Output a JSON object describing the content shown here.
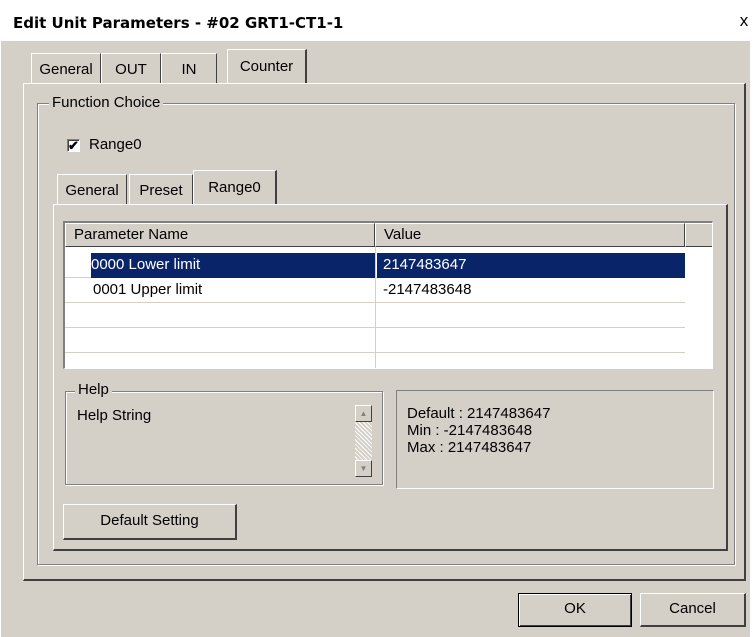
{
  "window": {
    "title": "Edit Unit Parameters - #02 GRT1-CT1-1",
    "close_glyph": "x"
  },
  "top_tabs": [
    "General",
    "OUT",
    "IN",
    "Counter"
  ],
  "function_choice": {
    "label": "Function Choice",
    "range_checkbox": {
      "label": "Range0",
      "checked": true,
      "mark": "✔"
    }
  },
  "sub_tabs": [
    "General",
    "Preset",
    "Range0"
  ],
  "param_table": {
    "columns": [
      "Parameter Name",
      "Value"
    ],
    "rows": [
      {
        "name": "0000 Lower limit",
        "value": "2147483647",
        "selected": true
      },
      {
        "name": "0001 Upper limit",
        "value": "-2147483648",
        "selected": false
      }
    ]
  },
  "help": {
    "label": "Help",
    "text": "Help String",
    "scroll_up": "▲",
    "scroll_down": "▼",
    "default_line": "Default : 2147483647",
    "min_line": "Min : -2147483648",
    "max_line": "Max : 2147483647"
  },
  "buttons": {
    "default_setting": "Default Setting",
    "ok": "OK",
    "cancel": "Cancel"
  },
  "colors": {
    "face": "#d4d0c8",
    "selection": "#0a246a"
  }
}
